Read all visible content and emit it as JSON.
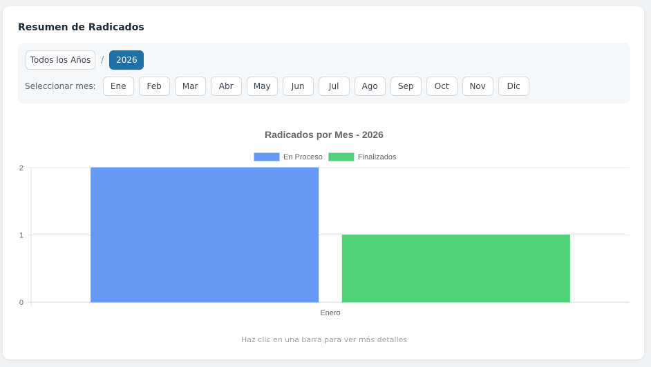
{
  "panel": {
    "title": "Resumen de Radicados"
  },
  "filters": {
    "all_years_label": "Todos los Años",
    "separator": "/",
    "selected_year": "2026",
    "month_prompt": "Seleccionar mes:",
    "months": [
      "Ene",
      "Feb",
      "Mar",
      "Abr",
      "May",
      "Jun",
      "Jul",
      "Ago",
      "Sep",
      "Oct",
      "Nov",
      "Dic"
    ]
  },
  "colors": {
    "accent": "#1f6fa8",
    "en_proceso": "#6699f5",
    "finalizados": "#4fd17a"
  },
  "chart_data": {
    "type": "bar",
    "title": "Radicados por Mes - 2026",
    "xlabel": "",
    "ylabel": "",
    "categories": [
      "Enero"
    ],
    "series": [
      {
        "name": "En Proceso",
        "values": [
          2
        ],
        "color": "#6699f5"
      },
      {
        "name": "Finalizados",
        "values": [
          1
        ],
        "color": "#4fd17a"
      }
    ],
    "ylim": [
      0,
      2
    ],
    "yticks": [
      0,
      1,
      2
    ],
    "grid": true,
    "legend": "top"
  },
  "footer": {
    "hint": "Haz clic en una barra para ver más detalles"
  }
}
